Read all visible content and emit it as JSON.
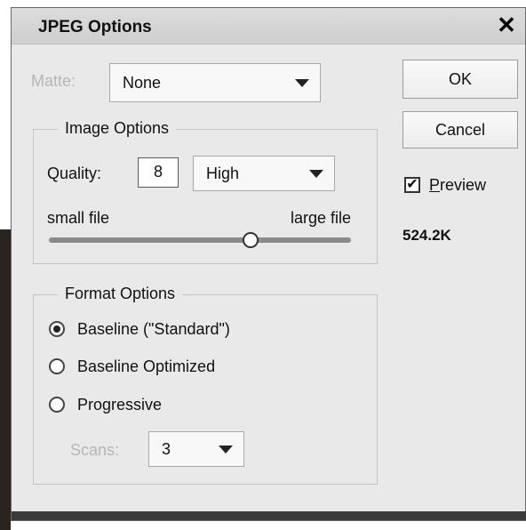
{
  "dialog": {
    "title": "JPEG Options",
    "close_glyph": "✕"
  },
  "matte": {
    "label": "Matte:",
    "value": "None"
  },
  "buttons": {
    "ok": "OK",
    "cancel": "Cancel"
  },
  "preview": {
    "checked": true,
    "label_first": "P",
    "label_rest": "review",
    "file_size": "524.2K"
  },
  "image_options": {
    "legend": "Image Options",
    "quality_label": "Quality:",
    "quality_value": "8",
    "quality_preset": "High",
    "small_label": "small file",
    "large_label": "large file",
    "quality_min": 0,
    "quality_max": 12
  },
  "format_options": {
    "legend": "Format Options",
    "options": [
      {
        "label": "Baseline (\"Standard\")",
        "selected": true
      },
      {
        "label": "Baseline Optimized",
        "selected": false
      },
      {
        "label": "Progressive",
        "selected": false
      }
    ],
    "scans_label": "Scans:",
    "scans_value": "3"
  },
  "icons": {
    "dropdown": "chevron-down-icon",
    "close": "close-icon",
    "check": "checkmark-icon"
  }
}
